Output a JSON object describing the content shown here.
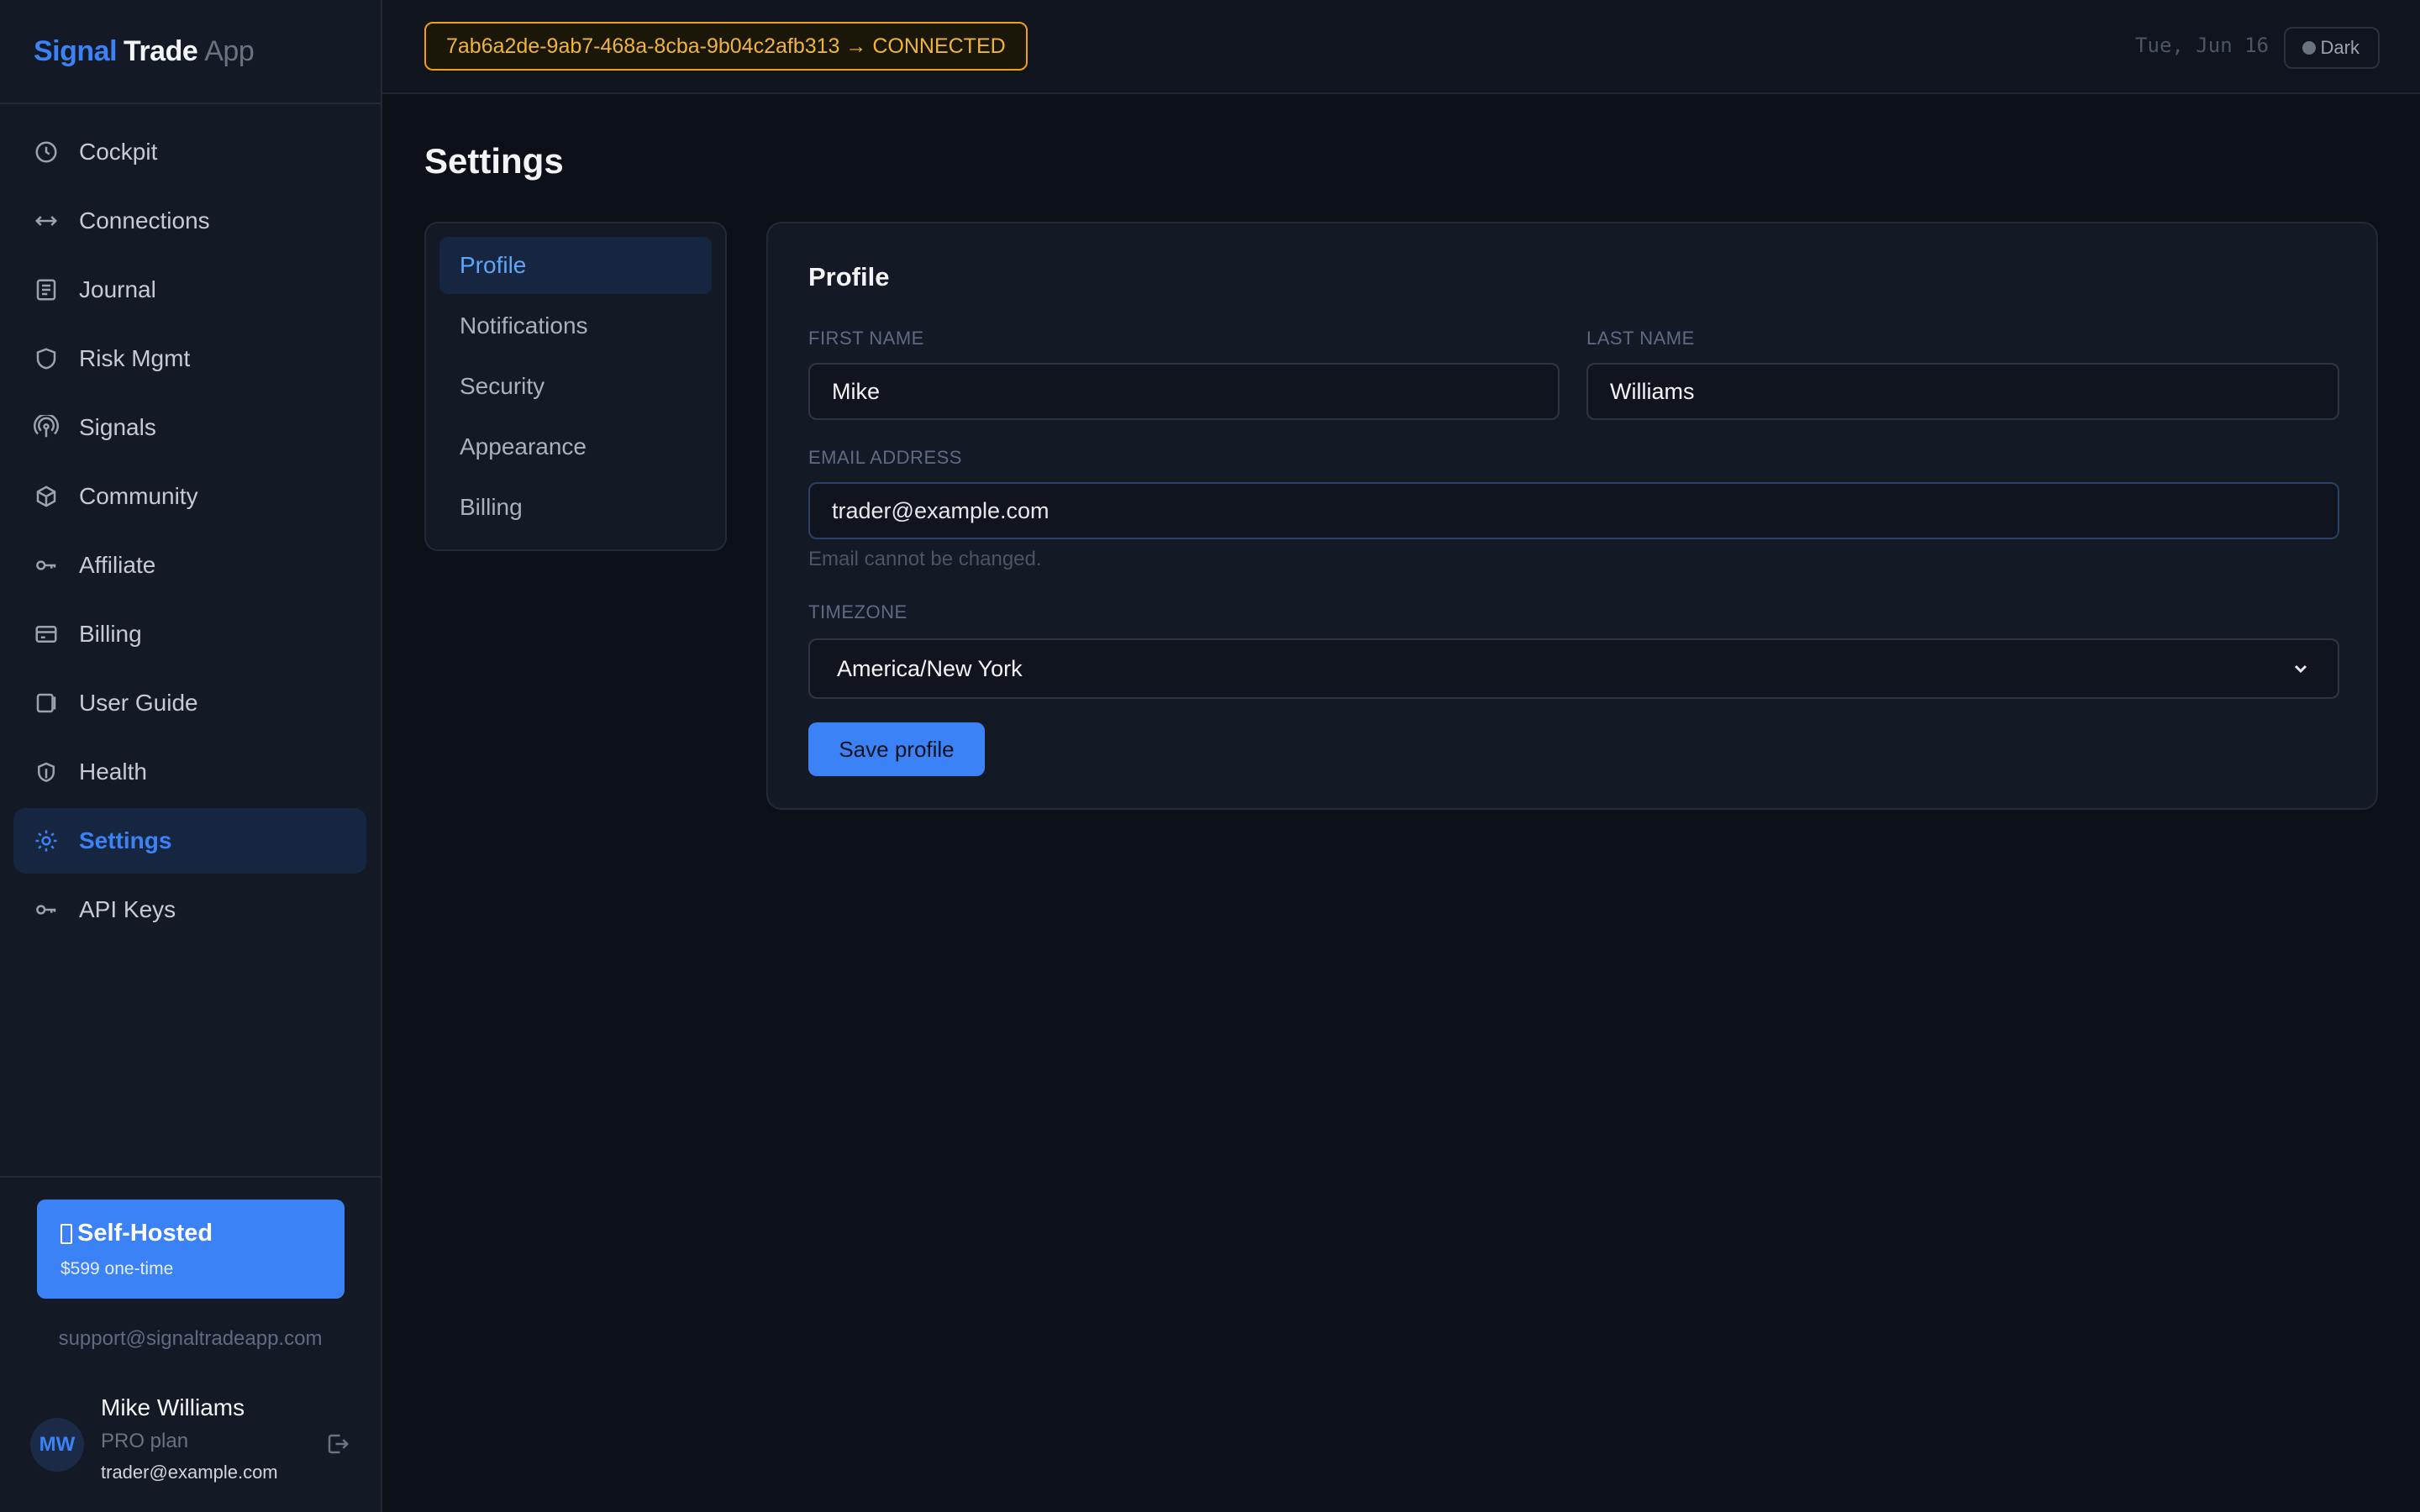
{
  "brand": {
    "signal": "Signal",
    "trade": "Trade",
    "app": "App"
  },
  "sidebar": {
    "items": [
      {
        "label": "Cockpit",
        "icon": "clock-icon"
      },
      {
        "label": "Connections",
        "icon": "arrows-horizontal-icon"
      },
      {
        "label": "Journal",
        "icon": "journal-icon"
      },
      {
        "label": "Risk Mgmt",
        "icon": "shield-icon"
      },
      {
        "label": "Signals",
        "icon": "broadcast-icon"
      },
      {
        "label": "Community",
        "icon": "cube-icon"
      },
      {
        "label": "Affiliate",
        "icon": "key-icon"
      },
      {
        "label": "Billing",
        "icon": "credit-card-icon"
      },
      {
        "label": "User Guide",
        "icon": "book-icon"
      },
      {
        "label": "Health",
        "icon": "heart-shield-icon"
      },
      {
        "label": "Settings",
        "icon": "gear-icon",
        "active": true
      },
      {
        "label": "API Keys",
        "icon": "key-icon"
      }
    ],
    "promo": {
      "title": "Self-Hosted",
      "subtitle": "$599 one-time"
    },
    "support_email": "support@signaltradeapp.com",
    "user": {
      "initials": "MW",
      "name": "Mike Williams",
      "plan": "PRO plan",
      "email": "trader@example.com"
    }
  },
  "topbar": {
    "connection": "7ab6a2de-9ab7-468a-8cba-9b04c2afb313 → CONNECTED",
    "date": "Tue, Jun 16",
    "theme": "Dark"
  },
  "page": {
    "title": "Settings"
  },
  "settings_nav": {
    "items": [
      {
        "label": "Profile",
        "active": true
      },
      {
        "label": "Notifications"
      },
      {
        "label": "Security"
      },
      {
        "label": "Appearance"
      },
      {
        "label": "Billing"
      }
    ]
  },
  "profile": {
    "title": "Profile",
    "first_name_label": "FIRST NAME",
    "first_name": "Mike",
    "last_name_label": "LAST NAME",
    "last_name": "Williams",
    "email_label": "EMAIL ADDRESS",
    "email": "trader@example.com",
    "email_help": "Email cannot be changed.",
    "timezone_label": "TIMEZONE",
    "timezone": "America/New York",
    "save_label": "Save profile"
  },
  "colors": {
    "accent": "#3b82f6",
    "background": "#0b0f18",
    "sidebar": "#131925",
    "connected_badge": "#f59e0b"
  }
}
